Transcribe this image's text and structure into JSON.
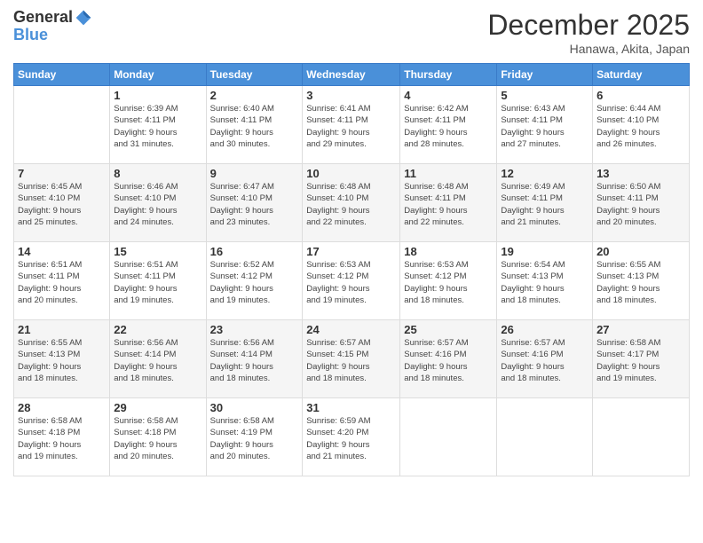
{
  "logo": {
    "general": "General",
    "blue": "Blue"
  },
  "title": "December 2025",
  "subtitle": "Hanawa, Akita, Japan",
  "days_header": [
    "Sunday",
    "Monday",
    "Tuesday",
    "Wednesday",
    "Thursday",
    "Friday",
    "Saturday"
  ],
  "weeks": [
    [
      {
        "day": "",
        "info": ""
      },
      {
        "day": "1",
        "info": "Sunrise: 6:39 AM\nSunset: 4:11 PM\nDaylight: 9 hours\nand 31 minutes."
      },
      {
        "day": "2",
        "info": "Sunrise: 6:40 AM\nSunset: 4:11 PM\nDaylight: 9 hours\nand 30 minutes."
      },
      {
        "day": "3",
        "info": "Sunrise: 6:41 AM\nSunset: 4:11 PM\nDaylight: 9 hours\nand 29 minutes."
      },
      {
        "day": "4",
        "info": "Sunrise: 6:42 AM\nSunset: 4:11 PM\nDaylight: 9 hours\nand 28 minutes."
      },
      {
        "day": "5",
        "info": "Sunrise: 6:43 AM\nSunset: 4:11 PM\nDaylight: 9 hours\nand 27 minutes."
      },
      {
        "day": "6",
        "info": "Sunrise: 6:44 AM\nSunset: 4:10 PM\nDaylight: 9 hours\nand 26 minutes."
      }
    ],
    [
      {
        "day": "7",
        "info": "Sunrise: 6:45 AM\nSunset: 4:10 PM\nDaylight: 9 hours\nand 25 minutes."
      },
      {
        "day": "8",
        "info": "Sunrise: 6:46 AM\nSunset: 4:10 PM\nDaylight: 9 hours\nand 24 minutes."
      },
      {
        "day": "9",
        "info": "Sunrise: 6:47 AM\nSunset: 4:10 PM\nDaylight: 9 hours\nand 23 minutes."
      },
      {
        "day": "10",
        "info": "Sunrise: 6:48 AM\nSunset: 4:10 PM\nDaylight: 9 hours\nand 22 minutes."
      },
      {
        "day": "11",
        "info": "Sunrise: 6:48 AM\nSunset: 4:11 PM\nDaylight: 9 hours\nand 22 minutes."
      },
      {
        "day": "12",
        "info": "Sunrise: 6:49 AM\nSunset: 4:11 PM\nDaylight: 9 hours\nand 21 minutes."
      },
      {
        "day": "13",
        "info": "Sunrise: 6:50 AM\nSunset: 4:11 PM\nDaylight: 9 hours\nand 20 minutes."
      }
    ],
    [
      {
        "day": "14",
        "info": "Sunrise: 6:51 AM\nSunset: 4:11 PM\nDaylight: 9 hours\nand 20 minutes."
      },
      {
        "day": "15",
        "info": "Sunrise: 6:51 AM\nSunset: 4:11 PM\nDaylight: 9 hours\nand 19 minutes."
      },
      {
        "day": "16",
        "info": "Sunrise: 6:52 AM\nSunset: 4:12 PM\nDaylight: 9 hours\nand 19 minutes."
      },
      {
        "day": "17",
        "info": "Sunrise: 6:53 AM\nSunset: 4:12 PM\nDaylight: 9 hours\nand 19 minutes."
      },
      {
        "day": "18",
        "info": "Sunrise: 6:53 AM\nSunset: 4:12 PM\nDaylight: 9 hours\nand 18 minutes."
      },
      {
        "day": "19",
        "info": "Sunrise: 6:54 AM\nSunset: 4:13 PM\nDaylight: 9 hours\nand 18 minutes."
      },
      {
        "day": "20",
        "info": "Sunrise: 6:55 AM\nSunset: 4:13 PM\nDaylight: 9 hours\nand 18 minutes."
      }
    ],
    [
      {
        "day": "21",
        "info": "Sunrise: 6:55 AM\nSunset: 4:13 PM\nDaylight: 9 hours\nand 18 minutes."
      },
      {
        "day": "22",
        "info": "Sunrise: 6:56 AM\nSunset: 4:14 PM\nDaylight: 9 hours\nand 18 minutes."
      },
      {
        "day": "23",
        "info": "Sunrise: 6:56 AM\nSunset: 4:14 PM\nDaylight: 9 hours\nand 18 minutes."
      },
      {
        "day": "24",
        "info": "Sunrise: 6:57 AM\nSunset: 4:15 PM\nDaylight: 9 hours\nand 18 minutes."
      },
      {
        "day": "25",
        "info": "Sunrise: 6:57 AM\nSunset: 4:16 PM\nDaylight: 9 hours\nand 18 minutes."
      },
      {
        "day": "26",
        "info": "Sunrise: 6:57 AM\nSunset: 4:16 PM\nDaylight: 9 hours\nand 18 minutes."
      },
      {
        "day": "27",
        "info": "Sunrise: 6:58 AM\nSunset: 4:17 PM\nDaylight: 9 hours\nand 19 minutes."
      }
    ],
    [
      {
        "day": "28",
        "info": "Sunrise: 6:58 AM\nSunset: 4:18 PM\nDaylight: 9 hours\nand 19 minutes."
      },
      {
        "day": "29",
        "info": "Sunrise: 6:58 AM\nSunset: 4:18 PM\nDaylight: 9 hours\nand 20 minutes."
      },
      {
        "day": "30",
        "info": "Sunrise: 6:58 AM\nSunset: 4:19 PM\nDaylight: 9 hours\nand 20 minutes."
      },
      {
        "day": "31",
        "info": "Sunrise: 6:59 AM\nSunset: 4:20 PM\nDaylight: 9 hours\nand 21 minutes."
      },
      {
        "day": "",
        "info": ""
      },
      {
        "day": "",
        "info": ""
      },
      {
        "day": "",
        "info": ""
      }
    ]
  ]
}
